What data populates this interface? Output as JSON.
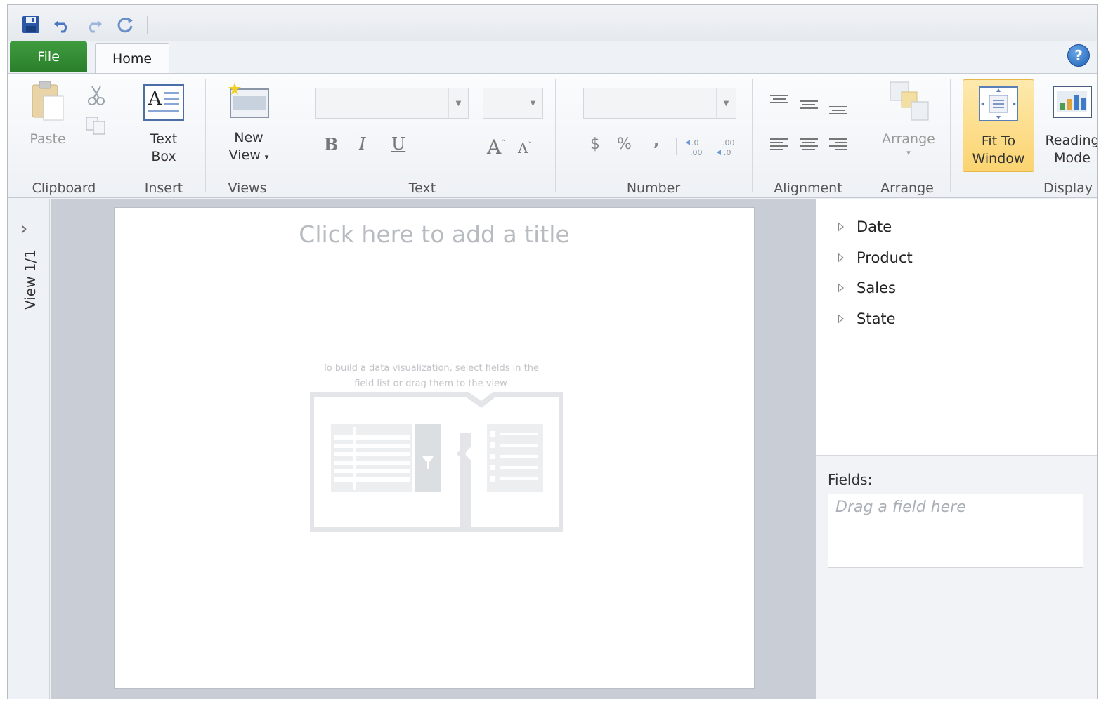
{
  "quick_access": {
    "icons": [
      "save-icon",
      "undo-icon",
      "redo-icon",
      "refresh-icon"
    ]
  },
  "tabs": {
    "file": "File",
    "home": "Home"
  },
  "ribbon": {
    "clipboard": {
      "paste": "Paste",
      "group": "Clipboard"
    },
    "insert": {
      "text_box_line1": "Text",
      "text_box_line2": "Box",
      "group": "Insert"
    },
    "views": {
      "new_view_line1": "New",
      "new_view_line2": "View",
      "group": "Views"
    },
    "text": {
      "font_name": "",
      "font_size": "",
      "bold": "B",
      "italic": "I",
      "underline": "U",
      "group": "Text"
    },
    "number": {
      "format": "",
      "currency": "$",
      "percent": "%",
      "comma": ",",
      "group": "Number"
    },
    "alignment": {
      "group": "Alignment"
    },
    "arrange": {
      "button": "Arrange",
      "group": "Arrange"
    },
    "display": {
      "fit_line1": "Fit To",
      "fit_line2": "Window",
      "reading_line1": "Reading",
      "reading_line2": "Mode",
      "group": "Display"
    }
  },
  "left_strip": {
    "view_label": "View 1/1"
  },
  "canvas": {
    "title_placeholder": "Click here to add a title",
    "hint_line1": "To build a data visualization, select fields in the",
    "hint_line2": "field list or drag them to the view"
  },
  "field_list": {
    "fields": [
      "Date",
      "Product",
      "Sales",
      "State"
    ],
    "fields_label": "Fields:",
    "drop_placeholder": "Drag a field here"
  }
}
